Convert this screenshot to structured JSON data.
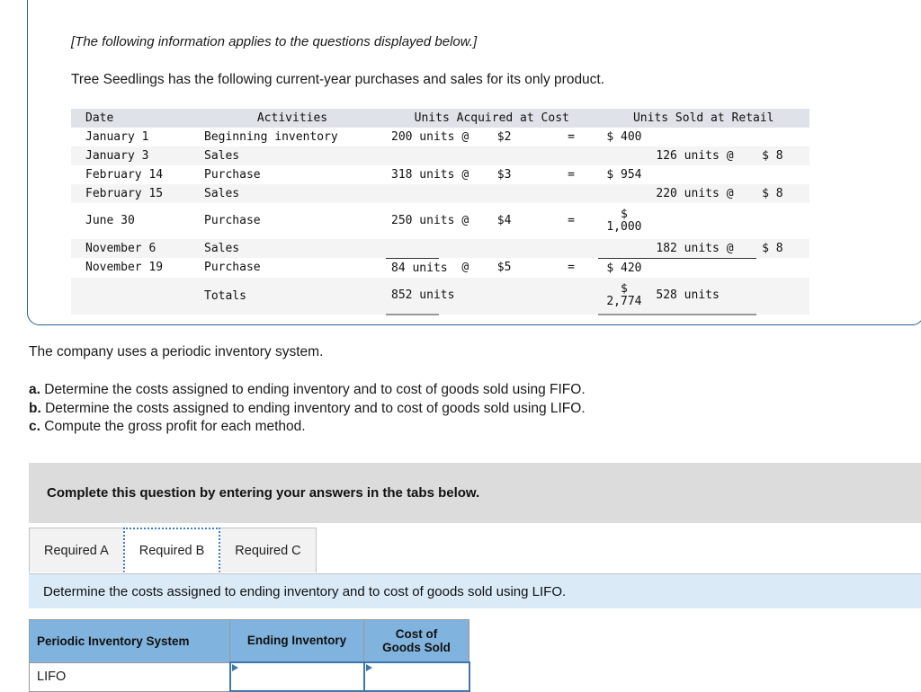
{
  "intro": {
    "bracket_note": "[The following information applies to the questions displayed below.]",
    "statement": "Tree Seedlings has the following current-year purchases and sales for its only product."
  },
  "activities_table": {
    "headers": {
      "date": "Date",
      "activities": "Activities",
      "units_acquired": "Units Acquired at Cost",
      "units_sold": "Units Sold at Retail"
    },
    "rows": [
      {
        "date": "January 1",
        "activity": "Beginning inventory",
        "acq_units": "200 units",
        "at": "@",
        "price": "$2",
        "eq": "=",
        "cost": "$ 400",
        "sold_units": "",
        "sold_at": "",
        "sold_price": ""
      },
      {
        "date": "January 3",
        "activity": "Sales",
        "acq_units": "",
        "at": "",
        "price": "",
        "eq": "",
        "cost": "",
        "sold_units": "126 units",
        "sold_at": "@",
        "sold_price": "$ 8"
      },
      {
        "date": "February 14",
        "activity": "Purchase",
        "acq_units": "318 units",
        "at": "@",
        "price": "$3",
        "eq": "=",
        "cost": "$ 954",
        "sold_units": "",
        "sold_at": "",
        "sold_price": ""
      },
      {
        "date": "February 15",
        "activity": "Sales",
        "acq_units": "",
        "at": "",
        "price": "",
        "eq": "",
        "cost": "",
        "sold_units": "220 units",
        "sold_at": "@",
        "sold_price": "$ 8"
      },
      {
        "date": "June 30",
        "activity": "Purchase",
        "acq_units": "250 units",
        "at": "@",
        "price": "$4",
        "eq": "=",
        "cost_top": "$",
        "cost_bottom": "1,000",
        "sold_units": "",
        "sold_at": "",
        "sold_price": ""
      },
      {
        "date": "November 6",
        "activity": "Sales",
        "acq_units": "",
        "at": "",
        "price": "",
        "eq": "",
        "cost": "",
        "sold_units": "182 units",
        "sold_at": "@",
        "sold_price": "$ 8"
      },
      {
        "date": "November 19",
        "activity": "Purchase",
        "acq_units": "84 units",
        "at": "@",
        "price": "$5",
        "eq": "=",
        "cost": "$ 420",
        "sold_units": "",
        "sold_at": "",
        "sold_price": ""
      }
    ],
    "totals": {
      "label": "Totals",
      "acq_units": "852 units",
      "cost_top": "$",
      "cost_bottom": "2,774",
      "sold_units": "528 units"
    }
  },
  "questions": {
    "system_note": "The company uses a periodic inventory system.",
    "items": [
      {
        "marker": "a.",
        "text": " Determine the costs assigned to ending inventory and to cost of goods sold using FIFO."
      },
      {
        "marker": "b.",
        "text": " Determine the costs assigned to ending inventory and to cost of goods sold using LIFO."
      },
      {
        "marker": "c.",
        "text": " Compute the gross profit for each method."
      }
    ]
  },
  "complete_bar": {
    "text": "Complete this question by entering your answers in the tabs below."
  },
  "tabs": {
    "items": [
      {
        "label": "Required A",
        "active": false
      },
      {
        "label": "Required B",
        "active": true
      },
      {
        "label": "Required C",
        "active": false
      }
    ]
  },
  "requirement_banner": {
    "text": "Determine the costs assigned to ending inventory and to cost of goods sold using LIFO."
  },
  "answer_table": {
    "headers": {
      "system": "Periodic Inventory System",
      "ending_inventory": "Ending Inventory",
      "cogs_line1": "Cost of",
      "cogs_line2": "Goods Sold"
    },
    "row": {
      "method": "LIFO",
      "ending_inventory_value": "",
      "cogs_value": ""
    }
  },
  "colors": {
    "panel_border": "#27618f",
    "table_header_bg": "#dfe3e9",
    "row_shade": "#f4f4f4",
    "complete_bar_bg": "#dcdcdc",
    "banner_bg": "#dbeaf7",
    "answer_header_bg": "#80b3dd",
    "input_border": "#3d77ab",
    "tab_focus": "#3b7fc4"
  }
}
